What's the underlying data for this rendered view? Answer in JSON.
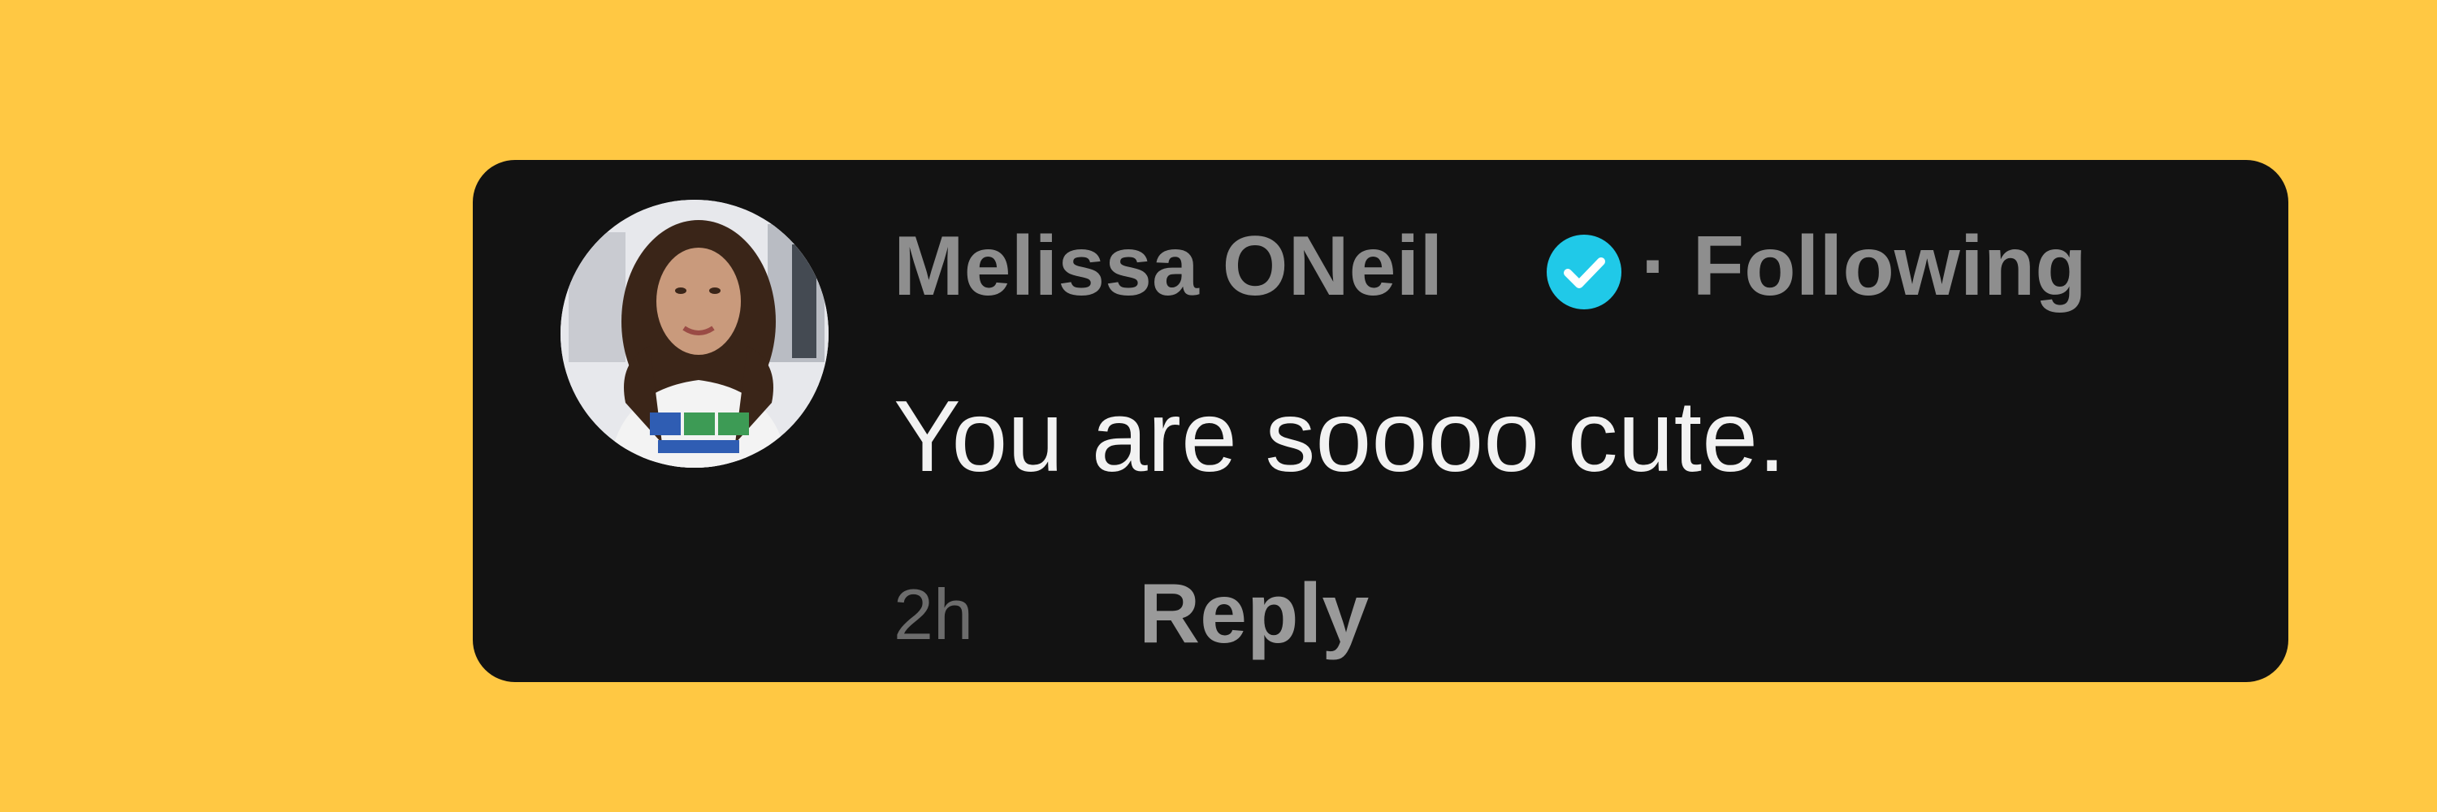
{
  "comment": {
    "username": "Melissa ONeil",
    "verified_icon": "verified-badge-icon",
    "separator": "·",
    "follow_status": "Following",
    "text": "You are soooo cute.",
    "timestamp": "2h",
    "reply_label": "Reply"
  },
  "colors": {
    "background": "#FFC843",
    "card": "#121212",
    "username": "#8E8E8E",
    "comment_text": "#F2F2F2",
    "timestamp": "#6C6C6C",
    "reply": "#9A9A9A",
    "verified": "#20C9E8"
  }
}
